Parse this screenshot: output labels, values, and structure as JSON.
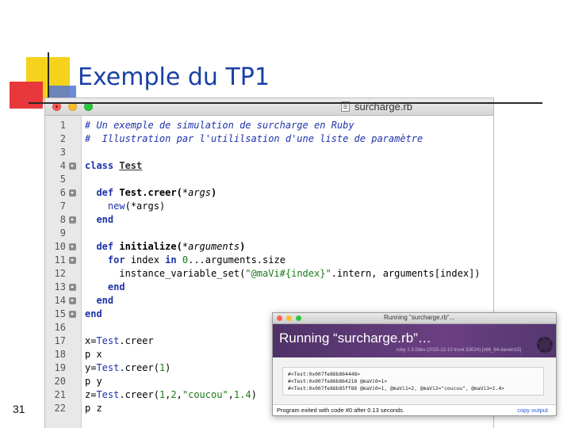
{
  "slide": {
    "title": "Exemple du TP1",
    "number": "31"
  },
  "editor": {
    "title": "surcharge.rb",
    "lines": [
      {
        "n": "1",
        "segs": [
          {
            "t": "# Un exemple de simulation de surcharge en Ruby",
            "c": "cm"
          }
        ]
      },
      {
        "n": "2",
        "segs": [
          {
            "t": "#  Illustration par l'utililsation d'une liste de paramètre",
            "c": "cm"
          }
        ]
      },
      {
        "n": "3",
        "segs": []
      },
      {
        "n": "4",
        "fold": "down",
        "segs": [
          {
            "t": "class ",
            "c": "kw"
          },
          {
            "t": "Test",
            "c": "cls"
          }
        ]
      },
      {
        "n": "5",
        "segs": []
      },
      {
        "n": "6",
        "fold": "down",
        "segs": [
          {
            "t": "  "
          },
          {
            "t": "def ",
            "c": "kw"
          },
          {
            "t": "Test.creer(",
            "c": "bold"
          },
          {
            "t": "*args",
            "c": "argi"
          },
          {
            "t": ")",
            "c": "bold"
          }
        ]
      },
      {
        "n": "7",
        "segs": [
          {
            "t": "    "
          },
          {
            "t": "new",
            "c": "kwb"
          },
          {
            "t": "(*args)"
          }
        ]
      },
      {
        "n": "8",
        "fold": "up",
        "segs": [
          {
            "t": "  "
          },
          {
            "t": "end",
            "c": "kw"
          }
        ]
      },
      {
        "n": "9",
        "segs": []
      },
      {
        "n": "10",
        "fold": "down",
        "segs": [
          {
            "t": "  "
          },
          {
            "t": "def ",
            "c": "kw"
          },
          {
            "t": "initialize(",
            "c": "bold"
          },
          {
            "t": "*arguments",
            "c": "argi"
          },
          {
            "t": ")",
            "c": "bold"
          }
        ]
      },
      {
        "n": "11",
        "fold": "down",
        "segs": [
          {
            "t": "    "
          },
          {
            "t": "for ",
            "c": "kw"
          },
          {
            "t": "index "
          },
          {
            "t": "in ",
            "c": "kw"
          },
          {
            "t": "0",
            "c": "num"
          },
          {
            "t": "...arguments.size"
          }
        ]
      },
      {
        "n": "12",
        "segs": [
          {
            "t": "      instance_variable_set("
          },
          {
            "t": "\"@maVi#{index}\"",
            "c": "str"
          },
          {
            "t": ".intern, arguments[index])"
          }
        ]
      },
      {
        "n": "13",
        "fold": "up",
        "segs": [
          {
            "t": "    "
          },
          {
            "t": "end",
            "c": "kw"
          }
        ]
      },
      {
        "n": "14",
        "fold": "up",
        "segs": [
          {
            "t": "  "
          },
          {
            "t": "end",
            "c": "kw"
          }
        ]
      },
      {
        "n": "15",
        "fold": "up",
        "segs": [
          {
            "t": "end",
            "c": "kw"
          }
        ]
      },
      {
        "n": "16",
        "segs": []
      },
      {
        "n": "17",
        "segs": [
          {
            "t": "x="
          },
          {
            "t": "Test",
            "c": "tcls"
          },
          {
            "t": ".creer"
          }
        ]
      },
      {
        "n": "18",
        "segs": [
          {
            "t": "p x"
          }
        ]
      },
      {
        "n": "19",
        "segs": [
          {
            "t": "y="
          },
          {
            "t": "Test",
            "c": "tcls"
          },
          {
            "t": ".creer("
          },
          {
            "t": "1",
            "c": "num"
          },
          {
            "t": ")"
          }
        ]
      },
      {
        "n": "20",
        "segs": [
          {
            "t": "p y"
          }
        ]
      },
      {
        "n": "21",
        "segs": [
          {
            "t": "z="
          },
          {
            "t": "Test",
            "c": "tcls"
          },
          {
            "t": ".creer("
          },
          {
            "t": "1",
            "c": "num"
          },
          {
            "t": ","
          },
          {
            "t": "2",
            "c": "num"
          },
          {
            "t": ","
          },
          {
            "t": "\"coucou\"",
            "c": "str"
          },
          {
            "t": ","
          },
          {
            "t": "1.4",
            "c": "num"
          },
          {
            "t": ")"
          }
        ]
      },
      {
        "n": "22",
        "segs": [
          {
            "t": "p z"
          }
        ]
      }
    ]
  },
  "run": {
    "window_title": "Running \"surcharge.rb\"...",
    "heading": "Running “surcharge.rb”…",
    "version": "ruby 2.3.0dev (2015-12-10 trunk 53024) [x86_64-darwin15]",
    "output": [
      "#<Test:0x007fe86b864448>",
      "#<Test:0x007fe86b864218 @maVi0=1>",
      "#<Test:0x007fe86b85ff88 @maVi0=1, @maVi1=2, @maVi2=\"coucou\", @maVi3=1.4>"
    ],
    "exit_message": "Program exited with code #0 after 0.13 seconds.",
    "copy_label": "copy output"
  }
}
